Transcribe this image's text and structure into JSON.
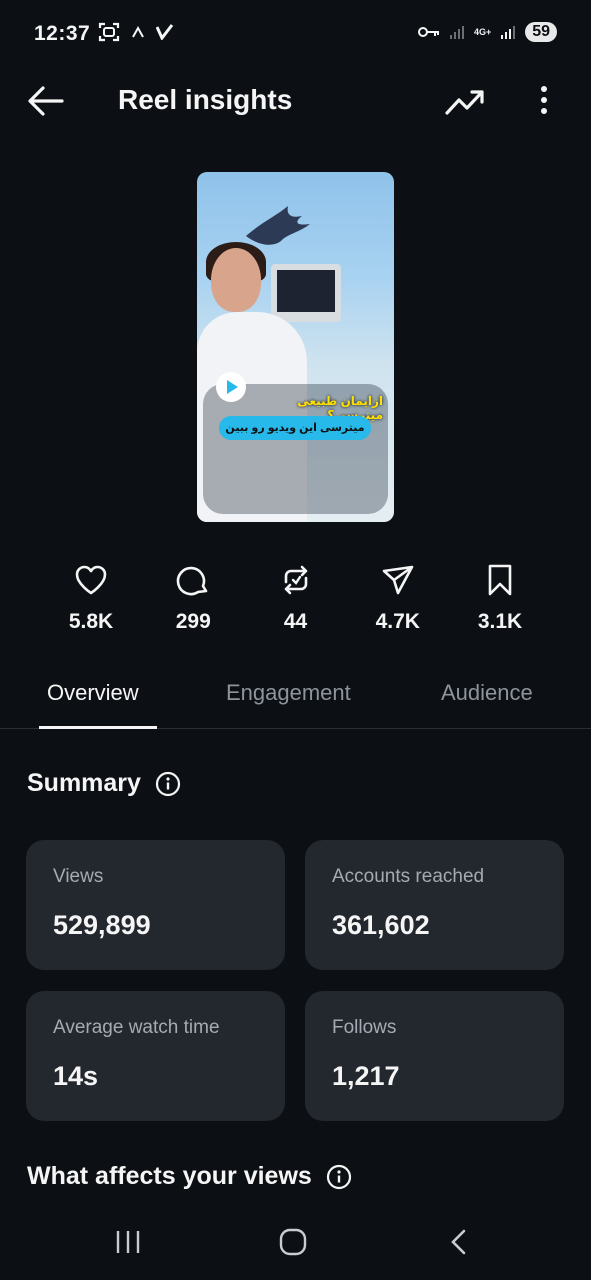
{
  "status_bar": {
    "time": "12:37",
    "network_label": "4G+",
    "battery": "59"
  },
  "header": {
    "title": "Reel insights"
  },
  "reel": {
    "caption_line1": "ازایمان طبیعی میترسی؟",
    "caption_line2": "میترسی این ویدیو رو ببین"
  },
  "stats": [
    {
      "icon": "heart-icon",
      "value": "5.8K"
    },
    {
      "icon": "comment-icon",
      "value": "299"
    },
    {
      "icon": "repost-icon",
      "value": "44"
    },
    {
      "icon": "share-icon",
      "value": "4.7K"
    },
    {
      "icon": "bookmark-icon",
      "value": "3.1K"
    }
  ],
  "tabs": [
    {
      "label": "Overview",
      "active": true
    },
    {
      "label": "Engagement",
      "active": false
    },
    {
      "label": "Audience",
      "active": false
    }
  ],
  "summary": {
    "title": "Summary",
    "cards": [
      {
        "label": "Views",
        "value": "529,899"
      },
      {
        "label": "Accounts reached",
        "value": "361,602"
      },
      {
        "label": "Average watch time",
        "value": "14s"
      },
      {
        "label": "Follows",
        "value": "1,217"
      }
    ]
  },
  "views_section": {
    "title": "What affects your views"
  },
  "colors": {
    "background": "#0c1014",
    "card": "#23272e",
    "text_primary": "#f5f5f5",
    "text_secondary": "#a5abb3"
  }
}
